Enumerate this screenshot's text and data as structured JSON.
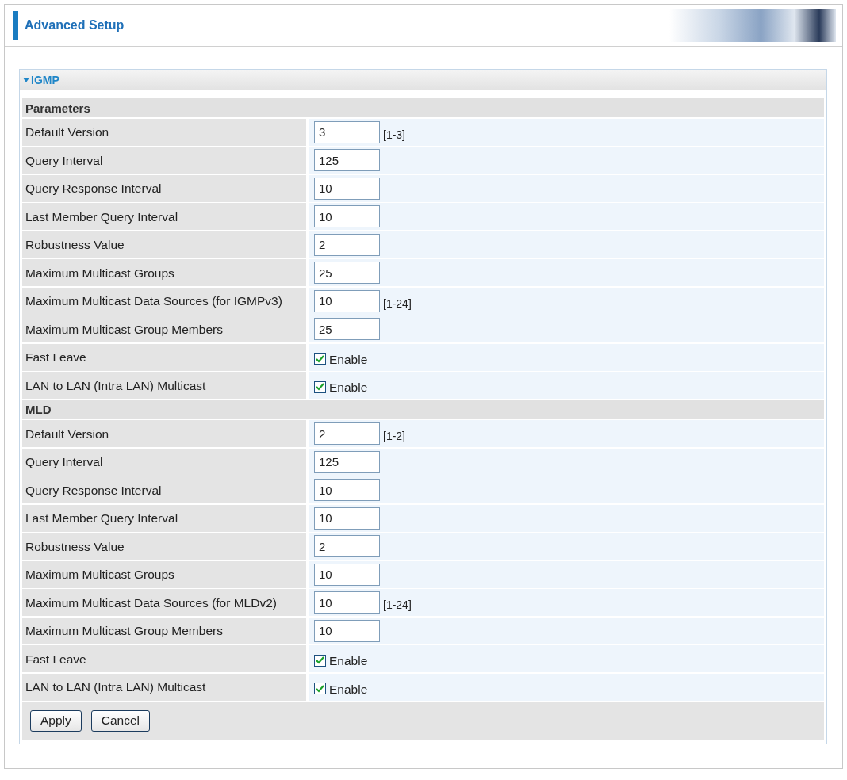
{
  "header": {
    "title": "Advanced Setup"
  },
  "panel": {
    "title": "IGMP",
    "expanded": true
  },
  "sections": [
    {
      "title": "Parameters",
      "rows": [
        {
          "kind": "text",
          "label": "Default Version",
          "value": "3",
          "hint": "[1-3]"
        },
        {
          "kind": "text",
          "label": "Query Interval",
          "value": "125"
        },
        {
          "kind": "text",
          "label": "Query Response Interval",
          "value": "10"
        },
        {
          "kind": "text",
          "label": "Last Member Query Interval",
          "value": "10"
        },
        {
          "kind": "text",
          "label": "Robustness Value",
          "value": "2"
        },
        {
          "kind": "text",
          "label": "Maximum Multicast Groups",
          "value": "25"
        },
        {
          "kind": "text",
          "label": "Maximum Multicast Data Sources (for IGMPv3)",
          "value": "10",
          "hint": "[1-24]"
        },
        {
          "kind": "text",
          "label": "Maximum Multicast Group Members",
          "value": "25"
        },
        {
          "kind": "checkbox",
          "label": "Fast Leave",
          "checked": true,
          "option": "Enable"
        },
        {
          "kind": "checkbox",
          "label": "LAN to LAN (Intra LAN) Multicast",
          "checked": true,
          "option": "Enable"
        }
      ]
    },
    {
      "title": "MLD",
      "rows": [
        {
          "kind": "text",
          "label": "Default Version",
          "value": "2",
          "hint": "[1-2]"
        },
        {
          "kind": "text",
          "label": "Query Interval",
          "value": "125"
        },
        {
          "kind": "text",
          "label": "Query Response Interval",
          "value": "10"
        },
        {
          "kind": "text",
          "label": "Last Member Query Interval",
          "value": "10"
        },
        {
          "kind": "text",
          "label": "Robustness Value",
          "value": "2"
        },
        {
          "kind": "text",
          "label": "Maximum Multicast Groups",
          "value": "10"
        },
        {
          "kind": "text",
          "label": "Maximum Multicast Data Sources (for MLDv2)",
          "value": "10",
          "hint": "[1-24]"
        },
        {
          "kind": "text",
          "label": "Maximum Multicast Group Members",
          "value": "10"
        },
        {
          "kind": "checkbox",
          "label": "Fast Leave",
          "checked": true,
          "option": "Enable"
        },
        {
          "kind": "checkbox",
          "label": "LAN to LAN (Intra LAN) Multicast",
          "checked": true,
          "option": "Enable"
        }
      ]
    }
  ],
  "buttons": [
    "Apply",
    "Cancel"
  ]
}
